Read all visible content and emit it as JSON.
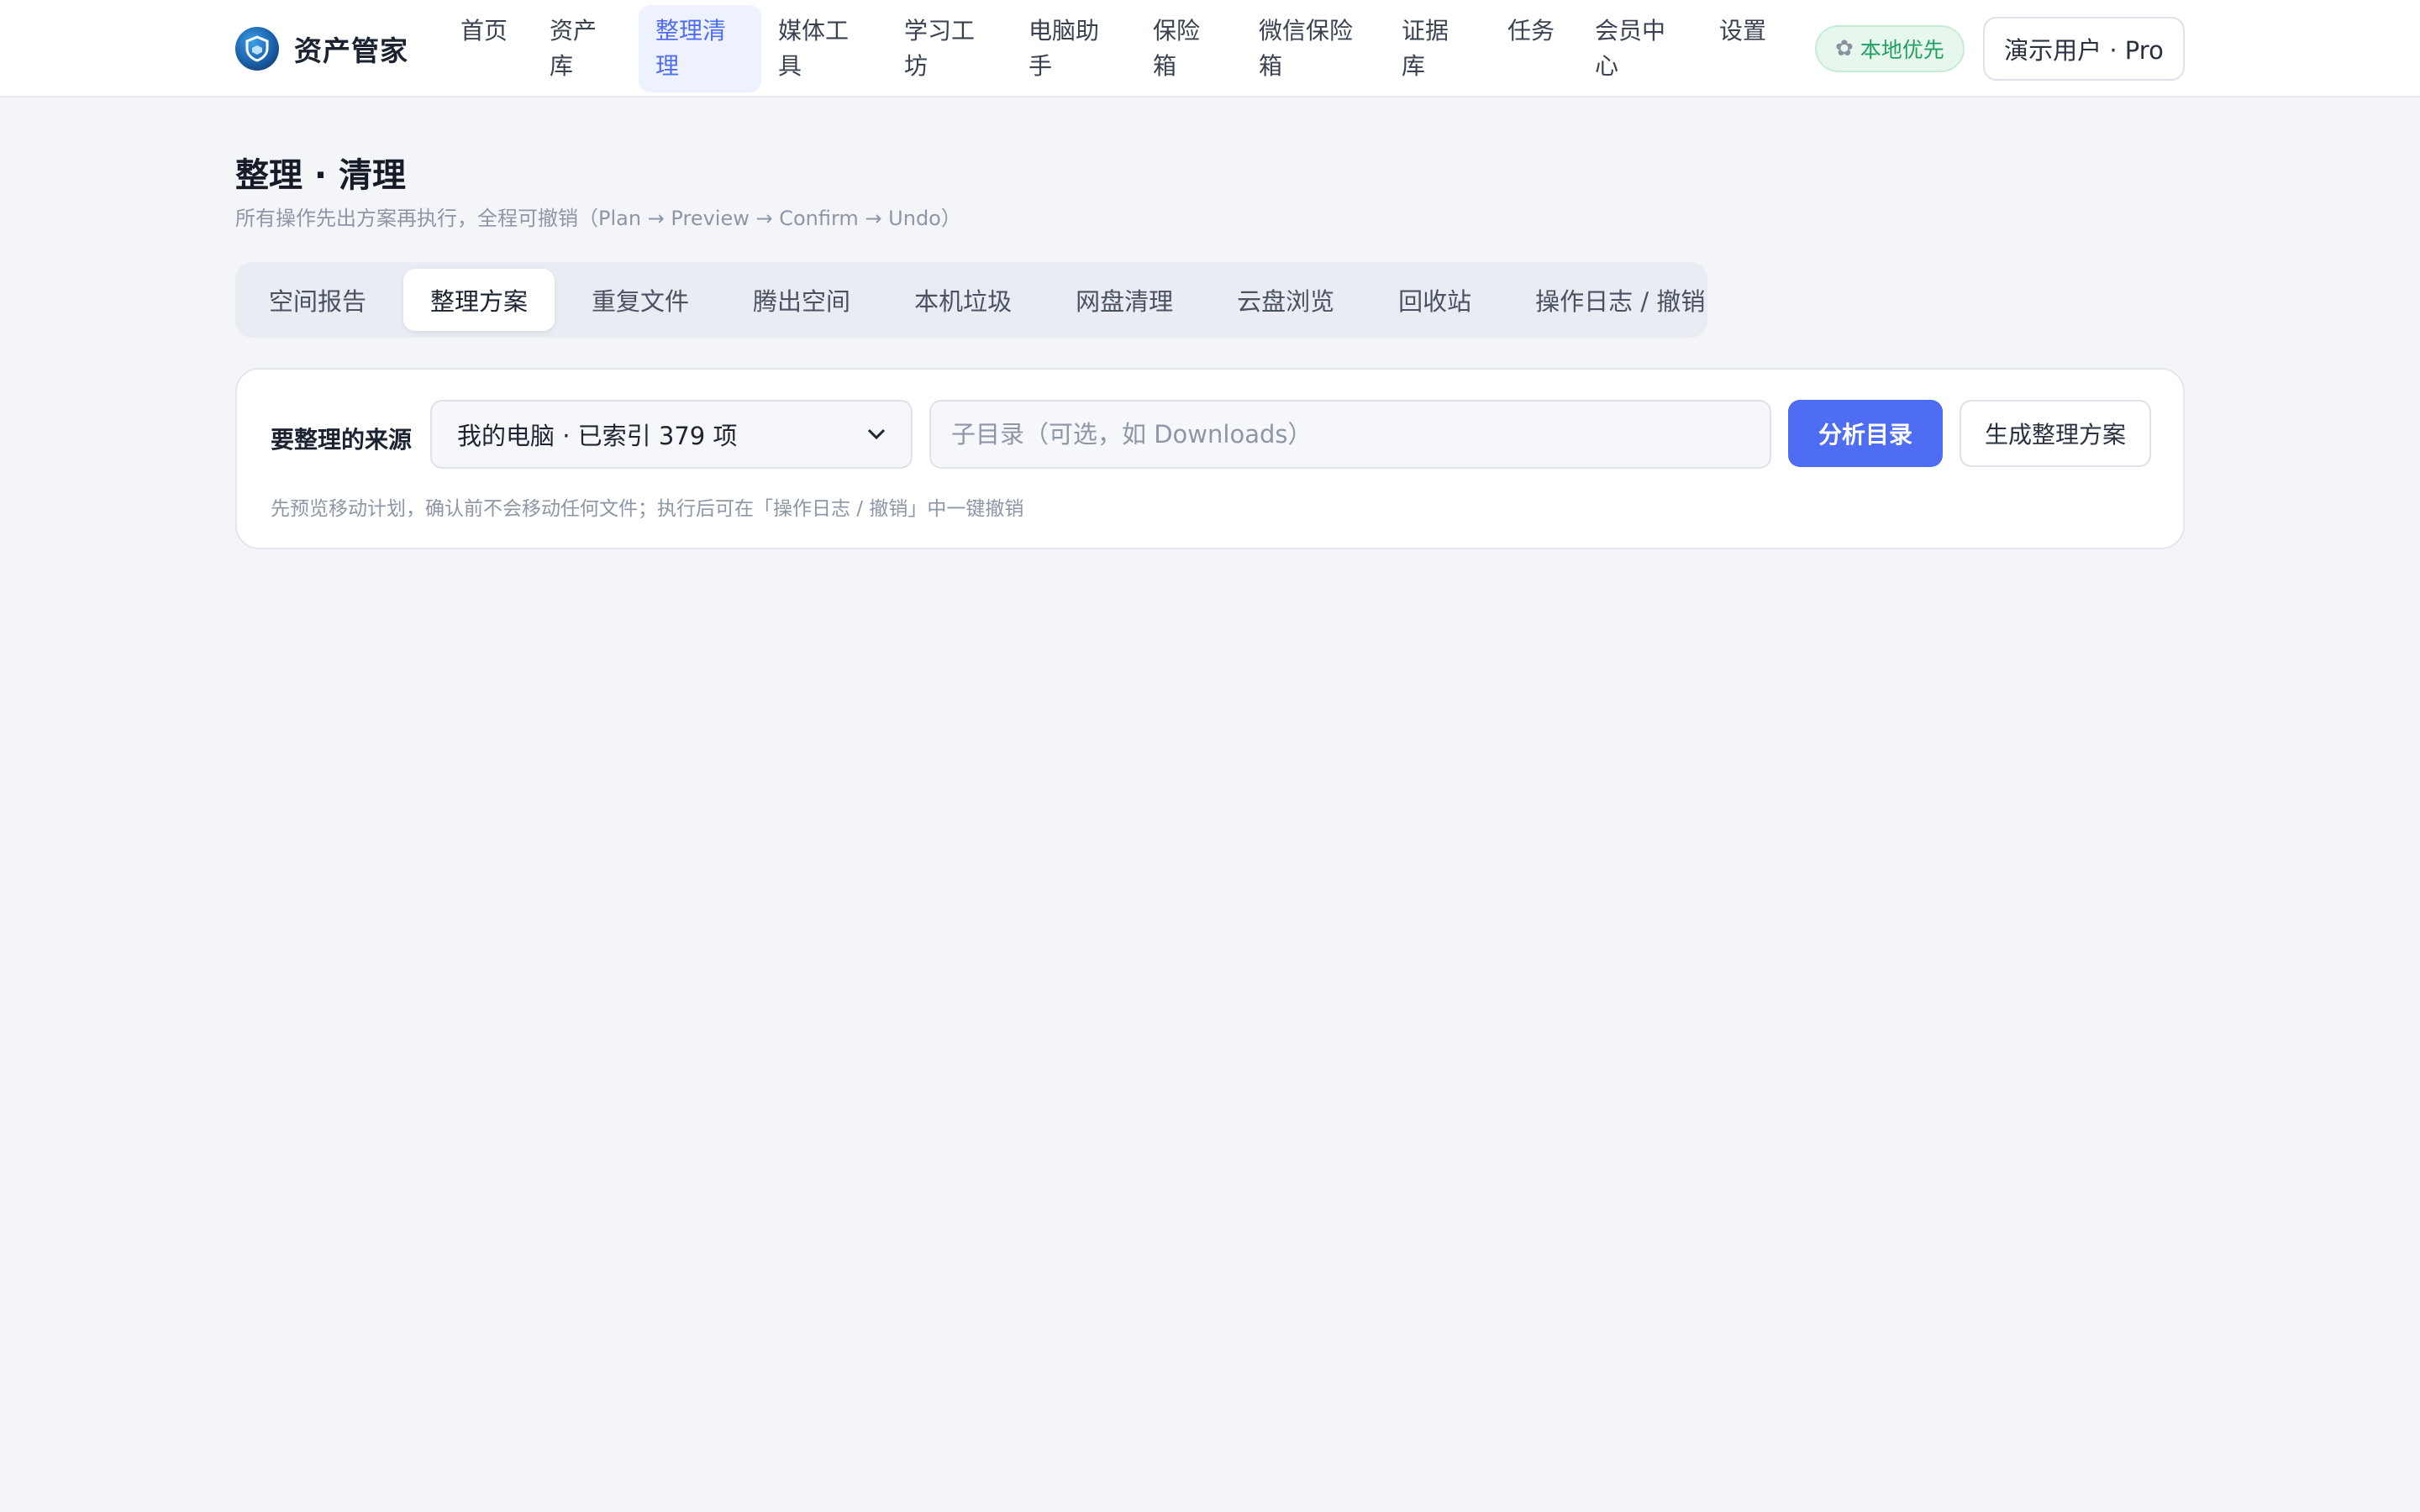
{
  "brand": {
    "name": "资产管家"
  },
  "nav": {
    "items": [
      {
        "label": "首页",
        "active": false
      },
      {
        "label": "资产库",
        "active": false
      },
      {
        "label": "整理清理",
        "active": true
      },
      {
        "label": "媒体工具",
        "active": false
      },
      {
        "label": "学习工坊",
        "active": false
      },
      {
        "label": "电脑助手",
        "active": false
      },
      {
        "label": "保险箱",
        "active": false
      },
      {
        "label": "微信保险箱",
        "active": false
      },
      {
        "label": "证据库",
        "active": false
      },
      {
        "label": "任务",
        "active": false
      },
      {
        "label": "会员中心",
        "active": false
      },
      {
        "label": "设置",
        "active": false
      }
    ]
  },
  "header_right": {
    "local_badge": "本地优先",
    "user_button": "演示用户 · Pro"
  },
  "page": {
    "title": "整理 · 清理",
    "subtitle": "所有操作先出方案再执行，全程可撤销（Plan → Preview → Confirm → Undo）"
  },
  "tabs": [
    {
      "label": "空间报告",
      "active": false
    },
    {
      "label": "整理方案",
      "active": true
    },
    {
      "label": "重复文件",
      "active": false
    },
    {
      "label": "腾出空间",
      "active": false
    },
    {
      "label": "本机垃圾",
      "active": false
    },
    {
      "label": "网盘清理",
      "active": false
    },
    {
      "label": "云盘浏览",
      "active": false
    },
    {
      "label": "回收站",
      "active": false
    },
    {
      "label": "操作日志 / 撤销",
      "active": false
    }
  ],
  "organize": {
    "source_label": "要整理的来源",
    "source_selected": "我的电脑 · 已索引 379 项",
    "subdir_value": "",
    "subdir_placeholder": "子目录（可选，如 Downloads）",
    "analyze_button": "分析目录",
    "plan_button": "生成整理方案",
    "hint": "先预览移动计划，确认前不会移动任何文件；执行后可在「操作日志 / 撤销」中一键撤销"
  },
  "colors": {
    "accent": "#4f6df2",
    "accent_bg": "#eef1fe",
    "badge_green": "#20a061",
    "badge_green_bg": "#e7f7ee",
    "page_bg": "#f4f5f9"
  },
  "icons": {
    "logo": "shield-logo-icon",
    "badge": "gear-icon",
    "select": "chevron-down-icon"
  }
}
